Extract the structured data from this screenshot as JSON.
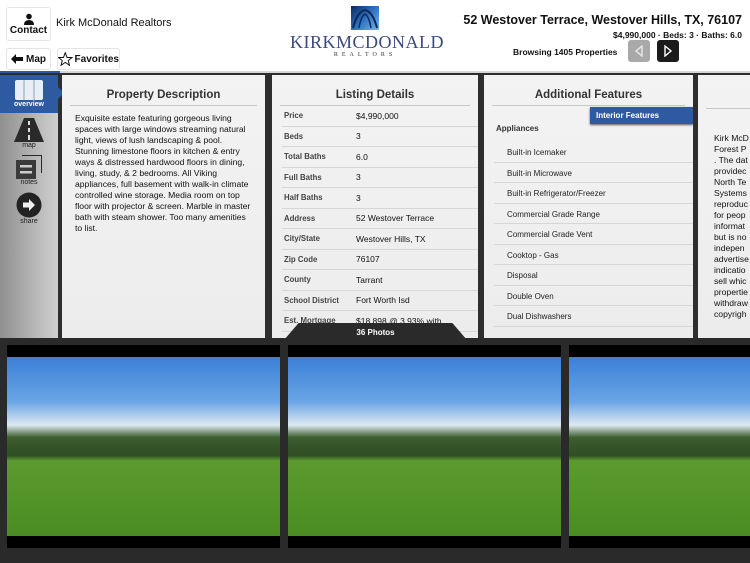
{
  "header": {
    "contact_label": "Contact",
    "agency_name": "Kirk McDonald Realtors",
    "map_label": "Map",
    "favorites_label": "Favorites",
    "logo_name": "KIRKMCDONALD",
    "logo_sub": "REALTORS",
    "address_title": "52 Westover Terrace, Westover Hills, TX, 76107",
    "summary": "$4,990,000 · Beds: 3 · Baths: 6.0",
    "browsing": "Browsing 1405 Properties",
    "prev_label": "Previous",
    "next_label": "Next",
    "accent_color": "#2d5aa0"
  },
  "sidebar": {
    "items": [
      {
        "label": "overview",
        "icon": "overview-icon",
        "active": true
      },
      {
        "label": "map",
        "icon": "road-icon",
        "active": false
      },
      {
        "label": "notes",
        "icon": "notes-icon",
        "active": false
      },
      {
        "label": "share",
        "icon": "share-arrow-icon",
        "active": false
      }
    ]
  },
  "description": {
    "title": "Property Description",
    "text": "Exquisite estate featuring gorgeous living spaces with large windows streaming natural light, views of lush landscaping & pool.  Stunning limestone floors in kitchen & entry ways & distressed hardwood floors in dining, living, study, & 2 bedrooms. All Viking appliances, full basement with walk-in climate controlled wine storage. Media room on top floor with projector & screen. Marble in master bath with steam shower.  Too many amenities to list."
  },
  "listing": {
    "title": "Listing Details",
    "rows": [
      {
        "label": "Price",
        "value": "$4,990,000"
      },
      {
        "label": "Beds",
        "value": "3"
      },
      {
        "label": "Total Baths",
        "value": "6.0"
      },
      {
        "label": "Full Baths",
        "value": "3"
      },
      {
        "label": "Half Baths",
        "value": "3"
      },
      {
        "label": "Address",
        "value": "52 Westover Terrace"
      },
      {
        "label": "City/State",
        "value": "Westover Hills, TX"
      },
      {
        "label": "Zip Code",
        "value": "76107"
      },
      {
        "label": "County",
        "value": "Tarrant"
      },
      {
        "label": "School District",
        "value": "Fort Worth Isd"
      },
      {
        "label": "Est. Mortgage",
        "value": "$18,898 @ 3.93% with"
      }
    ]
  },
  "features": {
    "title": "Additional Features",
    "tag": "Interior Features",
    "category": "Appliances",
    "items": [
      "Built-in Icemaker",
      "Built-in Microwave",
      "Built-in Refrigerator/Freezer",
      "Commercial Grade Range",
      "Commercial Grade Vent",
      "Cooktop - Gas",
      "Disposal",
      "Double Oven",
      "Dual Dishwashers"
    ]
  },
  "disclaimer": {
    "lines": [
      "Kirk McD",
      "Forest P",
      ". The dat",
      "providec",
      "North Te",
      "Systems",
      "reproduc",
      "for peop",
      "informat",
      "but is no",
      "indepen",
      "advertise",
      "indicatio",
      "sell whic",
      "propertie",
      "withdraw",
      "copyrigh"
    ]
  },
  "photos": {
    "count_label": "36 Photos",
    "items": [
      "front-walkway-photo",
      "front-walkway-photo-2",
      "side-lawn-photo"
    ]
  }
}
